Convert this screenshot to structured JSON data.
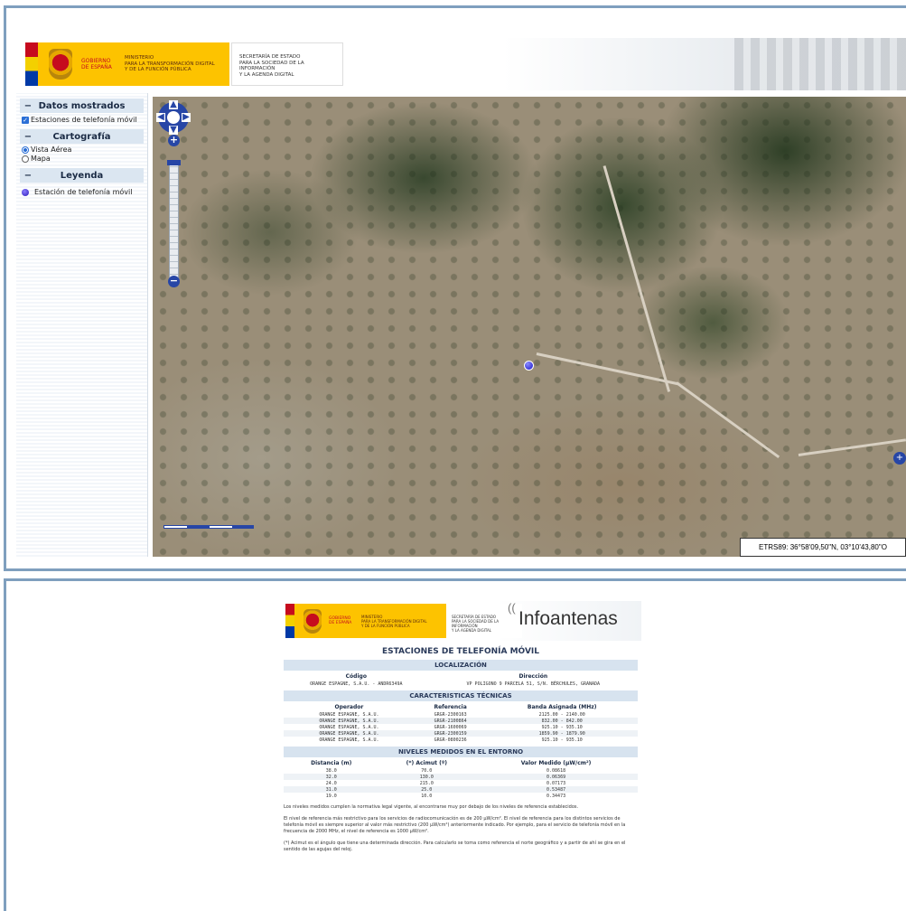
{
  "header": {
    "gov_line1": "GOBIERNO",
    "gov_line2": "DE ESPAÑA",
    "ministry_line1": "MINISTERIO",
    "ministry_line2": "PARA LA TRANSFORMACIÓN DIGITAL",
    "ministry_line3": "Y DE LA FUNCIÓN PÚBLICA",
    "secretary_line1": "SECRETARÍA DE ESTADO",
    "secretary_line2": "PARA LA SOCIEDAD DE LA INFORMACIÓN",
    "secretary_line3": "Y LA AGENDA DIGITAL"
  },
  "sidebar": {
    "data_title": "Datos mostrados",
    "data_checkbox_label": "Estaciones de telefonía móvil",
    "carto_title": "Cartografía",
    "carto_option_aerial": "Vista Aérea",
    "carto_option_map": "Mapa",
    "legend_title": "Leyenda",
    "legend_item": "Estación de telefonía móvil",
    "collapse_symbol": "−"
  },
  "map": {
    "coordinates": "ETRS89: 36°58'09,50\"N, 03°10'43,80\"O",
    "zoom_in": "+",
    "zoom_out": "−"
  },
  "info": {
    "brand": "Infoantenas",
    "title": "ESTACIONES DE TELEFONÍA MÓVIL",
    "location_title": "LOCALIZACIÓN",
    "col_code": "Código",
    "col_address": "Dirección",
    "code": "ORANGE ESPAGNE, S.A.U. - ANDR6349A",
    "address": "VP POLIGONO 9 PARCELA 51, S/N. BÉRCHULES, GRANADA",
    "tech_title": "CARACTERISTICAS TÉCNICAS",
    "col_operator": "Operador",
    "col_reference": "Referencia",
    "col_band": "Banda Asignada (MHz)",
    "tech_rows": [
      {
        "operator": "ORANGE ESPAGNE, S.A.U.",
        "reference": "GRGR-2300163",
        "band": "2125.00 - 2140.00"
      },
      {
        "operator": "ORANGE ESPAGNE, S.A.U.",
        "reference": "GRGR-2100864",
        "band": "832.00 - 842.00"
      },
      {
        "operator": "ORANGE ESPAGNE, S.A.U.",
        "reference": "GRGR-1600069",
        "band": "925.10 - 935.10"
      },
      {
        "operator": "ORANGE ESPAGNE, S.A.U.",
        "reference": "GRGR-2300159",
        "band": "1859.90 - 1879.90"
      },
      {
        "operator": "ORANGE ESPAGNE, S.A.U.",
        "reference": "GRGR-0800236",
        "band": "925.10 - 935.10"
      }
    ],
    "levels_title": "NIVELES MEDIDOS EN EL ENTORNO",
    "col_distance": "Distancia (m)",
    "col_azimuth": "(*) Acimut (º)",
    "col_value": "Valor Medido (µW/cm²)",
    "level_rows": [
      {
        "distance": "38.0",
        "azimuth": "70.0",
        "value": "0.08618"
      },
      {
        "distance": "32.0",
        "azimuth": "130.0",
        "value": "0.06369"
      },
      {
        "distance": "24.0",
        "azimuth": "215.0",
        "value": "0.07173"
      },
      {
        "distance": "31.0",
        "azimuth": "25.0",
        "value": "0.53487"
      },
      {
        "distance": "19.0",
        "azimuth": "10.0",
        "value": "0.34473"
      }
    ],
    "note1": "Los niveles medidos cumplen la normativa legal vigente, al encontrarse muy por debajo de los niveles de referencia establecidos.",
    "note2": "El nivel de referencia más restrictivo para los servicios de radiocomunicación es de 200 µW/cm². El nivel de referencia para los distintos servicios de telefonía móvil es siempre superior al valor más restrictivo (200 µW/cm²) anteriormente indicado. Por ejemplo, para el servicio de telefonía móvil en la frecuencia de 2000 MHz, el nivel de referencia es 1000 µW/cm².",
    "note3": "(*) Acimut es el ángulo que tiene una determinada dirección. Para calcularlo se toma como referencia el norte geográfico y a partir de ahí se gira en el sentido de las agujas del reloj."
  }
}
